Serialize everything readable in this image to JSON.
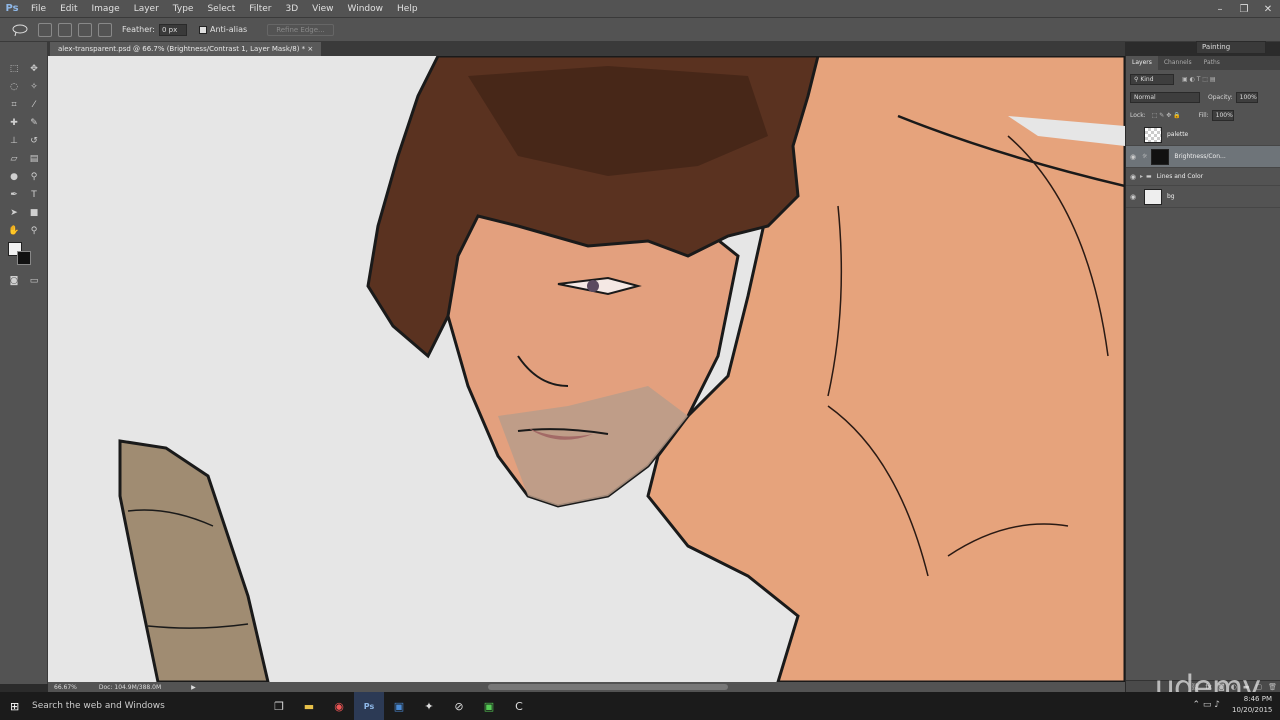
{
  "app": {
    "logo": "Ps",
    "menu": [
      "File",
      "Edit",
      "Image",
      "Layer",
      "Type",
      "Select",
      "Filter",
      "3D",
      "View",
      "Window",
      "Help"
    ],
    "workspace": "Painting"
  },
  "options": {
    "feather_label": "Feather:",
    "feather_value": "0 px",
    "antialias_label": "Anti-alias",
    "refine_edge_label": "Refine Edge..."
  },
  "document": {
    "tab_title": "alex-transparent.psd @ 66.7% (Brightness/Contrast 1, Layer Mask/8) *",
    "zoom": "66.67%",
    "doc_size": "Doc: 104.9M/388.0M"
  },
  "layers_panel": {
    "tabs": [
      "Layers",
      "Channels",
      "Paths"
    ],
    "kind_label": "Kind",
    "blend_mode": "Normal",
    "opacity_label": "Opacity:",
    "opacity_value": "100%",
    "lock_label": "Lock:",
    "fill_label": "Fill:",
    "fill_value": "100%",
    "layers": [
      {
        "name": "palette",
        "visible": false
      },
      {
        "name": "Brightness/Con...",
        "visible": true,
        "selected": true
      },
      {
        "name": "Lines and Color",
        "visible": true,
        "group": true
      },
      {
        "name": "bg",
        "visible": true
      }
    ]
  },
  "taskbar": {
    "search_placeholder": "Search the web and Windows",
    "time": "8:46 PM",
    "date": "10/20/2015"
  },
  "watermark": "udemy",
  "colors": {
    "chrome": "#535353",
    "canvas_bg": "#e6e6e6",
    "skin": "#e8a47c",
    "hair": "#4a2a1a",
    "spear": "#a08c72"
  }
}
